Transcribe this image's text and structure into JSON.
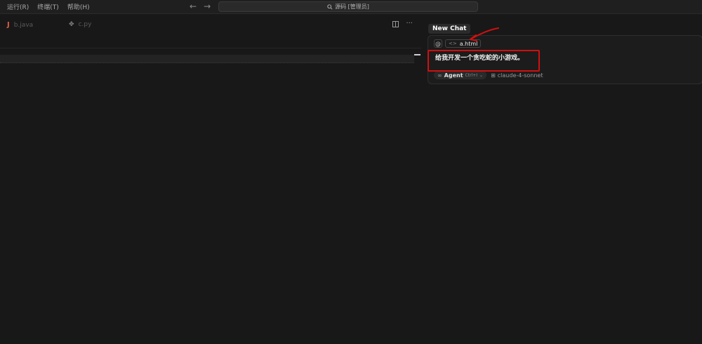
{
  "menu": {
    "items": [
      "运行(R)",
      "终端(T)",
      "帮助(H)"
    ]
  },
  "nav": {
    "back_icon": "arrow-left-icon",
    "forward_icon": "arrow-right-icon"
  },
  "search": {
    "text": "源码 [管理员]",
    "icon": "search-icon"
  },
  "editor": {
    "tabs": [
      {
        "label": "b.java",
        "icon": "java-icon",
        "glyph": "J"
      },
      {
        "label": "c.py",
        "icon": "python-icon",
        "glyph": "✥"
      }
    ],
    "actions": {
      "more": "···"
    }
  },
  "chat": {
    "tab_label": "New Chat",
    "context": {
      "at_symbol": "@",
      "file_name": "a.html",
      "file_icon_glyph": "<>"
    },
    "prompt": "给我开发一个贪吃蛇的小游戏。",
    "agent": {
      "icon_glyph": "∞",
      "label": "Agent",
      "shortcut": "Ctrl+I",
      "chevron": "⌄"
    },
    "model": {
      "icon_glyph": "⊞",
      "label": "claude-4-sonnet"
    }
  },
  "colors": {
    "background": "#181818",
    "annotation_red": "#d01010"
  }
}
